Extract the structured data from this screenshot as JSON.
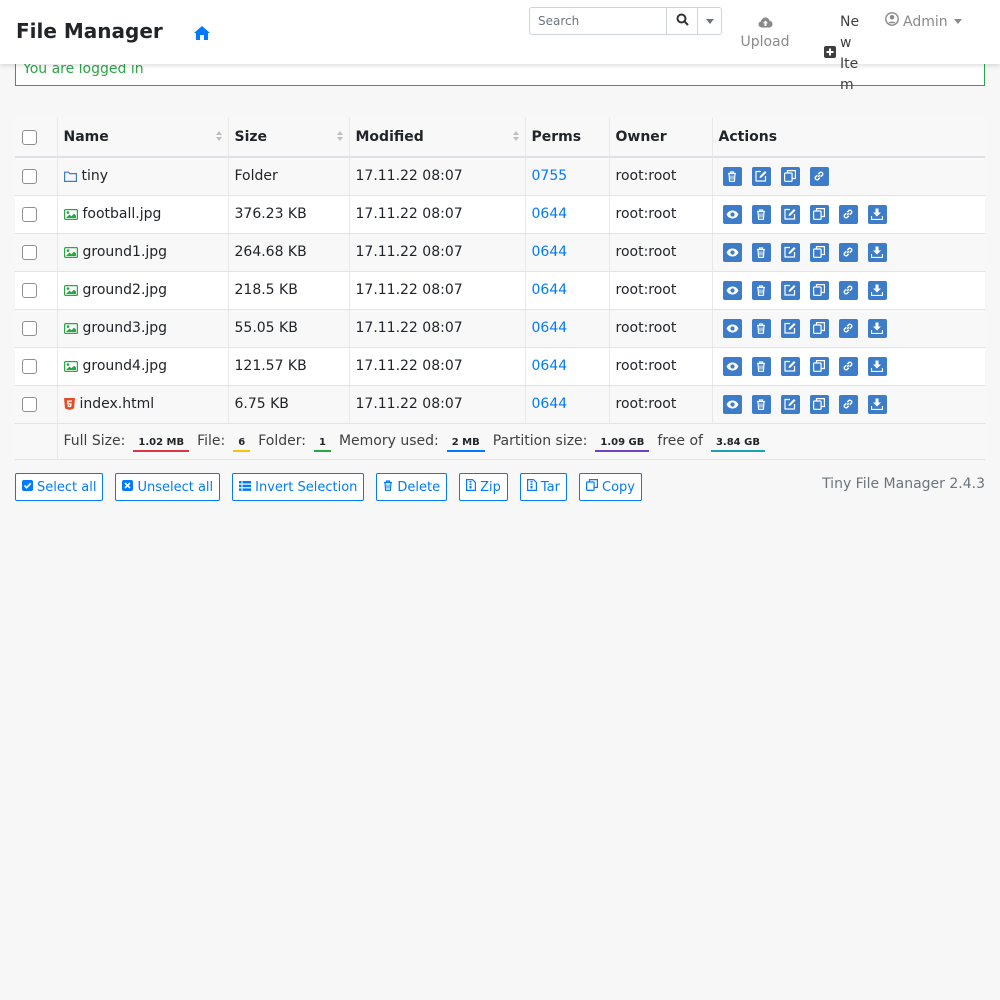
{
  "app": {
    "title": "File Manager",
    "version_text": "Tiny File Manager 2.4.3"
  },
  "nav": {
    "search_placeholder": "Search",
    "upload_label": "Upload",
    "new_item_label": "New Item",
    "admin_label": "Admin"
  },
  "alert": {
    "message": "You are logged in"
  },
  "table": {
    "headers": {
      "name": "Name",
      "size": "Size",
      "modified": "Modified",
      "perms": "Perms",
      "owner": "Owner",
      "actions": "Actions"
    },
    "rows": [
      {
        "name": "tiny",
        "icon": "folder-icon",
        "size": "Folder",
        "modified": "17.11.22 08:07",
        "perms": "0755",
        "owner": "root:root",
        "actions": [
          "delete",
          "rename",
          "copy",
          "direct-link"
        ]
      },
      {
        "name": "football.jpg",
        "icon": "image-icon",
        "size": "376.23 KB",
        "modified": "17.11.22 08:07",
        "perms": "0644",
        "owner": "root:root",
        "actions": [
          "view",
          "delete",
          "rename",
          "copy",
          "direct-link",
          "download"
        ]
      },
      {
        "name": "ground1.jpg",
        "icon": "image-icon",
        "size": "264.68 KB",
        "modified": "17.11.22 08:07",
        "perms": "0644",
        "owner": "root:root",
        "actions": [
          "view",
          "delete",
          "rename",
          "copy",
          "direct-link",
          "download"
        ]
      },
      {
        "name": "ground2.jpg",
        "icon": "image-icon",
        "size": "218.5 KB",
        "modified": "17.11.22 08:07",
        "perms": "0644",
        "owner": "root:root",
        "actions": [
          "view",
          "delete",
          "rename",
          "copy",
          "direct-link",
          "download"
        ]
      },
      {
        "name": "ground3.jpg",
        "icon": "image-icon",
        "size": "55.05 KB",
        "modified": "17.11.22 08:07",
        "perms": "0644",
        "owner": "root:root",
        "actions": [
          "view",
          "delete",
          "rename",
          "copy",
          "direct-link",
          "download"
        ]
      },
      {
        "name": "ground4.jpg",
        "icon": "image-icon",
        "size": "121.57 KB",
        "modified": "17.11.22 08:07",
        "perms": "0644",
        "owner": "root:root",
        "actions": [
          "view",
          "delete",
          "rename",
          "copy",
          "direct-link",
          "download"
        ]
      },
      {
        "name": "index.html",
        "icon": "html5-icon",
        "size": "6.75 KB",
        "modified": "17.11.22 08:07",
        "perms": "0644",
        "owner": "root:root",
        "actions": [
          "view",
          "delete",
          "rename",
          "copy",
          "direct-link",
          "download"
        ]
      }
    ]
  },
  "stats": {
    "full_size_label": "Full Size:",
    "full_size_value": "1.02 MB",
    "file_label": "File:",
    "file_value": "6",
    "folder_label": "Folder:",
    "folder_value": "1",
    "memory_label": "Memory used:",
    "memory_value": "2 MB",
    "partition_label": "Partition size:",
    "partition_value": "1.09 GB",
    "free_label": "free of",
    "free_value": "3.84 GB"
  },
  "buttons": {
    "select_all": "Select all",
    "unselect_all": "Unselect all",
    "invert_selection": "Invert Selection",
    "delete": "Delete",
    "zip": "Zip",
    "tar": "Tar",
    "copy": "Copy"
  },
  "colors": {
    "accent": "#007bff",
    "success": "#28a745",
    "action_button": "#3d7cc9",
    "image_icon": "#28a745",
    "html_icon": "#e34c26",
    "badge_full_size": "#dc3545",
    "badge_file": "#ffc107",
    "badge_folder": "#28a745",
    "badge_memory": "#007bff",
    "badge_partition": "#6f42c1",
    "badge_free": "#17a2b8"
  }
}
